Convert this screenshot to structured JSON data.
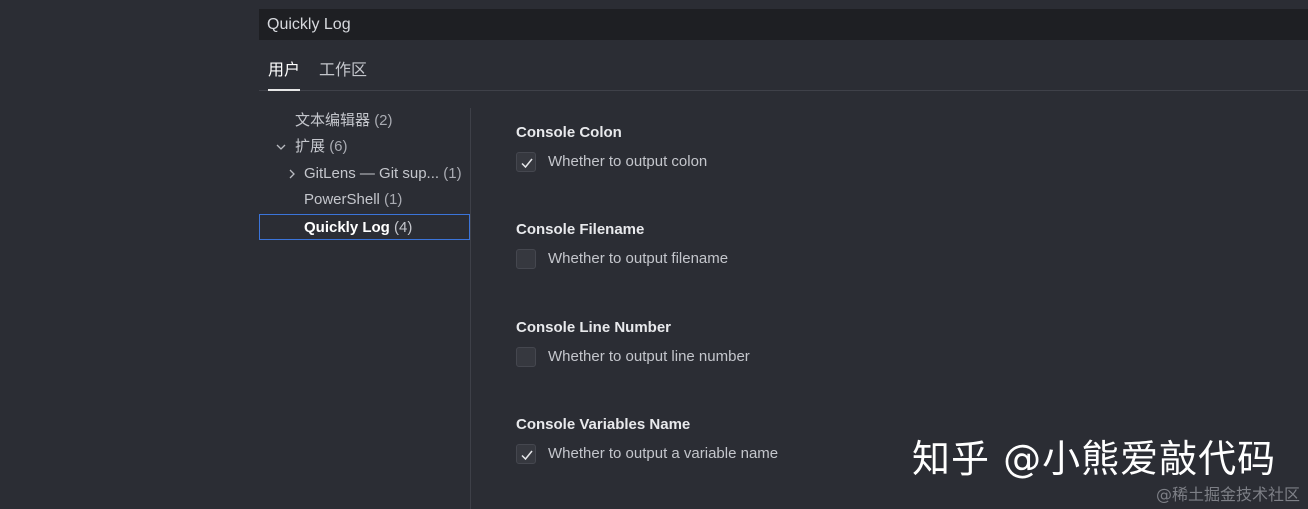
{
  "search": {
    "value": "Quickly Log"
  },
  "tabs": [
    {
      "label": "用户",
      "active": true
    },
    {
      "label": "工作区",
      "active": false
    }
  ],
  "toc": {
    "items": [
      {
        "label": "文本编辑器",
        "count": "(2)"
      },
      {
        "label": "扩展",
        "count": "(6)",
        "chevron": "chevron-down-icon"
      },
      {
        "label": "GitLens — Git sup...",
        "count": "(1)",
        "chevron": "chevron-right-icon"
      },
      {
        "label": "PowerShell",
        "count": "(1)"
      },
      {
        "label": "Quickly Log",
        "count": "(4)",
        "selected": true
      }
    ]
  },
  "settings": [
    {
      "title": "Console Colon",
      "description": "Whether to output colon",
      "checked": true
    },
    {
      "title": "Console Filename",
      "description": "Whether to output filename",
      "checked": false
    },
    {
      "title": "Console Line Number",
      "description": "Whether to output line number",
      "checked": false
    },
    {
      "title": "Console Variables Name",
      "description": "Whether to output a variable name",
      "checked": true
    }
  ],
  "watermark": {
    "main": "知乎 @小熊爱敲代码",
    "secondary": "@稀土掘金技术社区"
  },
  "colors": {
    "background": "#2b2d34",
    "search_background": "#1e1f23",
    "selection_border": "#3b74d9",
    "text": "#c4c6cc"
  }
}
